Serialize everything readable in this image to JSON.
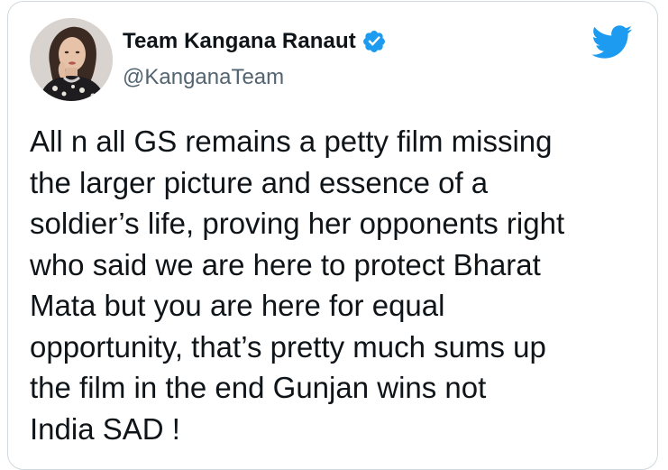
{
  "tweet": {
    "author": {
      "display_name": "Team Kangana Ranaut",
      "handle": "@KanganaTeam",
      "verified": true,
      "verified_icon": "verified-badge-icon",
      "avatar": "profile-photo"
    },
    "platform_icon": "twitter-bird-icon",
    "text_lines": [
      "All n all GS remains a petty film missing",
      "the larger picture and essence of a",
      "soldier’s life, proving her opponents right",
      "who said we are here to protect Bharat",
      "Mata but you are here for equal",
      "opportunity, that’s pretty much sums up",
      "the film in the end Gunjan wins not",
      "India SAD !"
    ]
  },
  "colors": {
    "twitter_blue": "#1d9bf0",
    "text_primary": "#0f1419",
    "text_secondary": "#536471",
    "border": "#cfd9de"
  }
}
